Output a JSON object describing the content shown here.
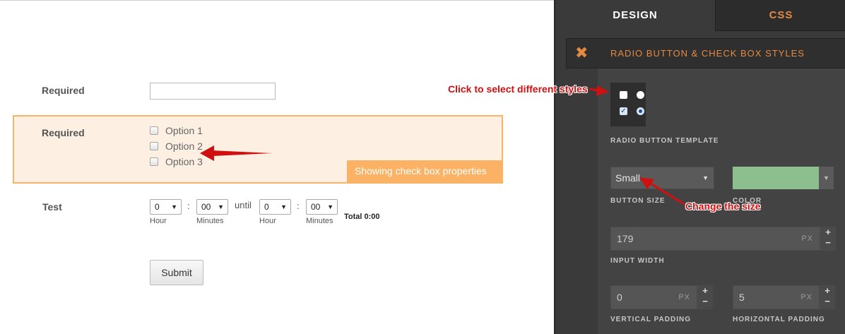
{
  "form": {
    "row1_label": "Required",
    "row2_label": "Required",
    "options": [
      "Option 1",
      "Option 2",
      "Option 3"
    ],
    "highlight_badge": "Showing check box properties",
    "row3_label": "Test",
    "time": {
      "start_hour": "0",
      "start_minute": "00",
      "until": "until",
      "end_hour": "0",
      "end_minute": "00",
      "colon": ":",
      "hour_label": "Hour",
      "minutes_label": "Minutes",
      "total": "Total 0:00"
    },
    "submit_label": "Submit"
  },
  "panel": {
    "tabs": {
      "design": "DESIGN",
      "css": "CSS"
    },
    "section_title": "RADIO BUTTON & CHECK BOX STYLES",
    "close_icon": "✖",
    "template_label": "RADIO BUTTON TEMPLATE",
    "button_size": {
      "value": "Small",
      "label": "BUTTON SIZE",
      "arrow": "▼"
    },
    "color": {
      "label": "COLOR",
      "value": "#8dbf8e",
      "arrow": "▼"
    },
    "input_width": {
      "value": "179",
      "unit": "PX",
      "label": "INPUT WIDTH"
    },
    "vertical_padding": {
      "value": "0",
      "unit": "PX",
      "label": "VERTICAL PADDING"
    },
    "horizontal_padding": {
      "value": "5",
      "unit": "PX",
      "label": "HORIZONTAL PADDING"
    },
    "plus": "+",
    "minus": "−"
  },
  "annotations": {
    "styles": "Click to select different styles",
    "size": "Change the size"
  },
  "colors": {
    "accent": "#e58a45",
    "highlight": "#fdf0e3",
    "badge": "#fbb265",
    "annotation": "#d01010"
  }
}
